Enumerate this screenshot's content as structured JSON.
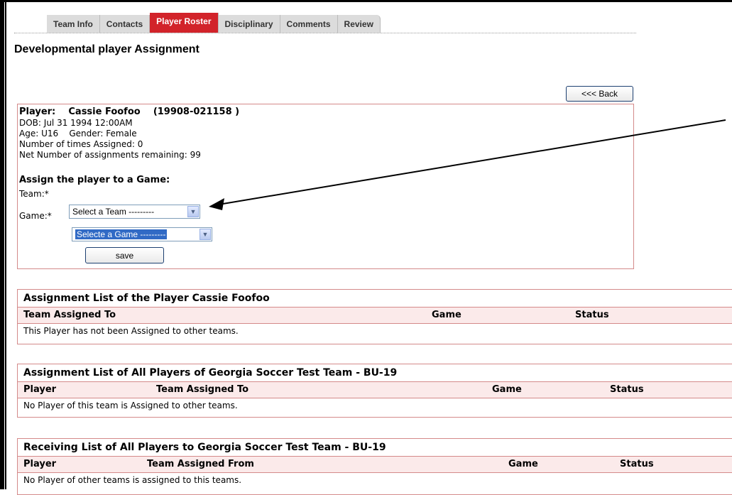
{
  "tabs": [
    "Team Info",
    "Contacts",
    "Player Roster",
    "Disciplinary",
    "Comments",
    "Review"
  ],
  "active_tab": "Player Roster",
  "page_title": "Developmental player Assignment",
  "back_button": "<<< Back",
  "player": {
    "label": "Player:",
    "name": "Cassie Foofoo",
    "id": "(19908-021158 )",
    "dob": "DOB: Jul 31 1994 12:00AM",
    "age_gender": "Age: U16    Gender: Female",
    "times_assigned": "Number of times Assigned: 0",
    "remaining": "Net Number of assignments remaining: 99"
  },
  "assign": {
    "heading": "Assign the player to a Game:",
    "team_label": "Team:*",
    "team_select": "Select a Team ---------",
    "game_label": "Game:*",
    "game_select": "Selecte a Game ---------",
    "save_label": "save"
  },
  "list1": {
    "title": "Assignment List of the Player Cassie Foofoo",
    "headers": [
      "Team Assigned To",
      "Game",
      "Status"
    ],
    "empty": "This Player has not been Assigned to other teams."
  },
  "list2": {
    "title": "Assignment List of All Players of Georgia Soccer Test Team - BU-19",
    "headers": [
      "Player",
      "Team Assigned To",
      "Game",
      "Status"
    ],
    "empty": "No Player of this team is Assigned to other teams."
  },
  "list3": {
    "title": "Receiving List of All Players to Georgia Soccer Test Team - BU-19",
    "headers": [
      "Player",
      "Team Assigned From",
      "Game",
      "Status"
    ],
    "empty": "No Player of other teams is assigned to this teams."
  },
  "colors": {
    "active_tab": "#d2232a",
    "border": "#d48a8a",
    "header_bg": "#fbeaea"
  },
  "icons": [
    "chevron-down-icon",
    "annotation-arrow"
  ]
}
